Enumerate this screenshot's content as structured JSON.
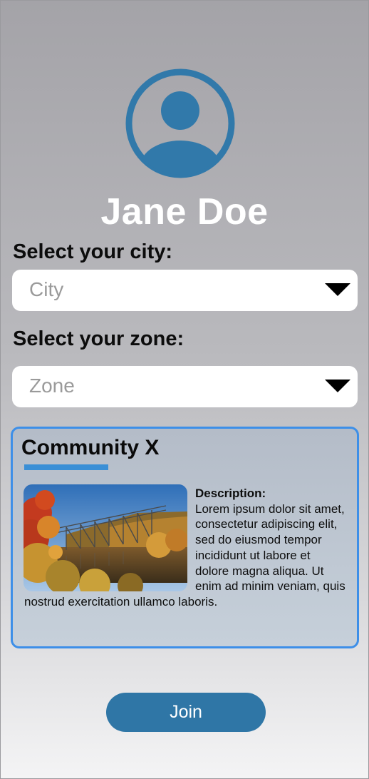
{
  "profile": {
    "name": "Jane Doe",
    "avatar_icon": "user-avatar-icon"
  },
  "city": {
    "label": "Select your city:",
    "placeholder": "City"
  },
  "zone": {
    "label": "Select your zone:",
    "placeholder": "Zone"
  },
  "community": {
    "title": "Community X",
    "description_heading": "Description:",
    "description_text": "Lorem ipsum dolor sit amet, consectetur adipiscing elit, sed do eiusmod tempor incididunt ut labore et dolore magna aliqua. Ut enim ad minim veniam, quis nostrud exercitation ullamco laboris.",
    "image_subject": "railway bridge over river with autumn foliage"
  },
  "actions": {
    "join_label": "Join"
  },
  "colors": {
    "accent": "#2f76a6",
    "card_border": "#3d8fe8",
    "avatar": "#3179aa"
  }
}
